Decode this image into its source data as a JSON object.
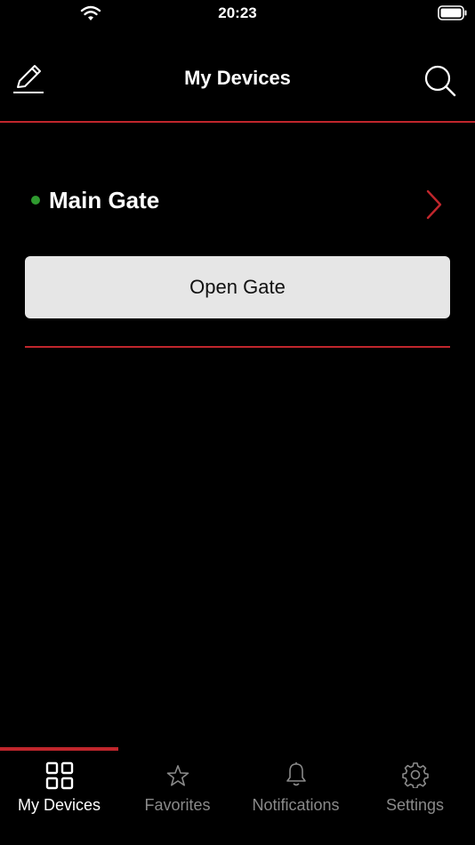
{
  "status_bar": {
    "time": "20:23"
  },
  "header": {
    "title": "My Devices"
  },
  "device": {
    "name": "Main Gate",
    "status_color": "#2f9a2f",
    "action_label": "Open Gate"
  },
  "tab_bar": {
    "tabs": [
      {
        "label": "My Devices",
        "icon": "grid-icon",
        "active": true
      },
      {
        "label": "Favorites",
        "icon": "star-icon",
        "active": false
      },
      {
        "label": "Notifications",
        "icon": "bell-icon",
        "active": false
      },
      {
        "label": "Settings",
        "icon": "gear-icon",
        "active": false
      }
    ]
  },
  "colors": {
    "accent": "#c0262c",
    "background": "#000000",
    "button": "#e6e6e6"
  }
}
